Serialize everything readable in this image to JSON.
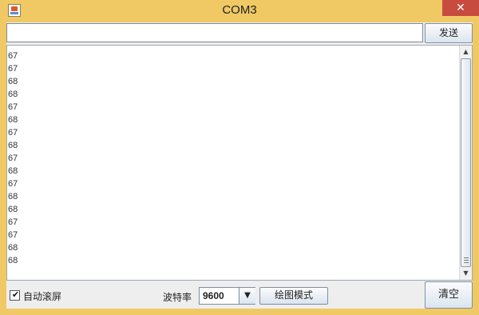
{
  "window": {
    "title": "COM3",
    "close_glyph": "✕",
    "icon": "java-app-icon"
  },
  "send": {
    "input_value": "",
    "button_label": "发送"
  },
  "output": {
    "lines": [
      "67",
      "67",
      "67",
      "68",
      "68",
      "67",
      "68",
      "67",
      "68",
      "67",
      "68",
      "67",
      "68",
      "68",
      "67",
      "67",
      "68",
      "68"
    ]
  },
  "controls": {
    "autoscroll_label": "自动滚屏",
    "autoscroll_checked": true,
    "baud_label": "波特率",
    "baud_value": "9600",
    "plot_button_label": "绘图模式",
    "clear_button_label": "清空"
  },
  "colors": {
    "frame": "#f0c965",
    "close": "#c74b3e"
  }
}
